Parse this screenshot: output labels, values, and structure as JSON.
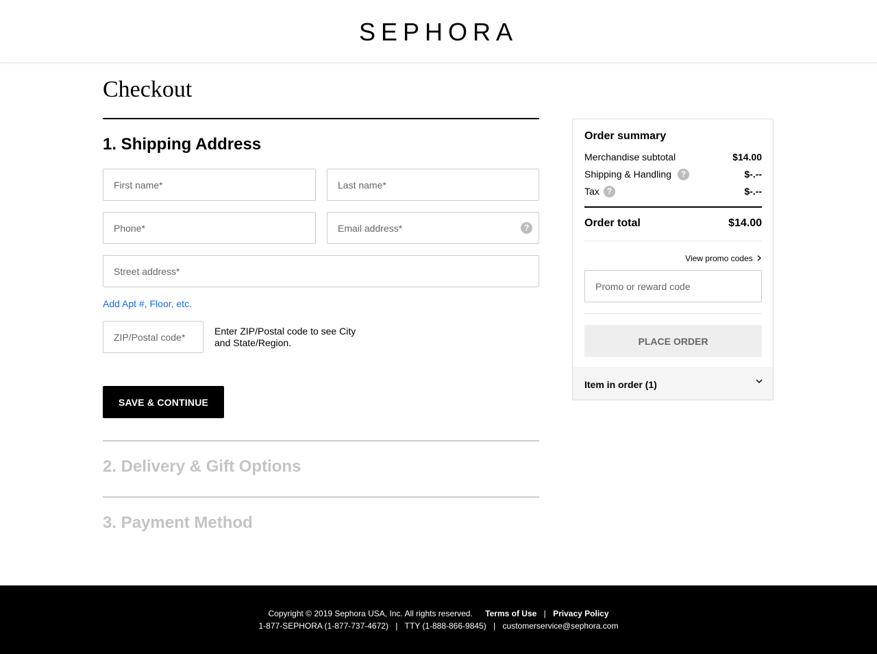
{
  "brand": {
    "logo": "SEPHORA"
  },
  "page": {
    "title": "Checkout"
  },
  "shipping": {
    "section_title": "1. Shipping Address",
    "first_name_placeholder": "First name*",
    "last_name_placeholder": "Last name*",
    "phone_placeholder": "Phone*",
    "email_placeholder": "Email address*",
    "street_placeholder": "Street address*",
    "add_apt_link": "Add Apt #, Floor, etc.",
    "zip_placeholder": "ZIP/Postal code*",
    "zip_hint": "Enter ZIP/Postal code to see City and State/Region.",
    "save_button": "SAVE & CONTINUE"
  },
  "sections": {
    "delivery": "2. Delivery & Gift Options",
    "payment": "3. Payment Method"
  },
  "summary": {
    "title": "Order summary",
    "merch_label": "Merchandise subtotal",
    "merch_value": "$14.00",
    "shipping_label": "Shipping & Handling",
    "shipping_value": "$-.--",
    "tax_label": "Tax",
    "tax_value": "$-.--",
    "total_label": "Order total",
    "total_value": "$14.00",
    "promo_link": "View promo codes",
    "promo_placeholder": "Promo or reward code",
    "place_order": "PLACE ORDER",
    "items_label": "Item in order (1)"
  },
  "icons": {
    "help": "question-mark-icon",
    "chevron_right": "chevron-right-icon",
    "chevron_down": "chevron-down-icon"
  },
  "footer": {
    "copyright": "Copyright © 2019 Sephora USA, Inc. All rights reserved.",
    "terms": "Terms of Use",
    "privacy": "Privacy Policy",
    "phone": "1-877-SEPHORA (1-877-737-4672)",
    "tty": "TTY (1-888-866-9845)",
    "email": "customerservice@sephora.com",
    "separator": "|"
  },
  "colors": {
    "link_blue": "#136bea",
    "inactive_grey": "#c4c4c4",
    "primary_black": "#000000"
  }
}
